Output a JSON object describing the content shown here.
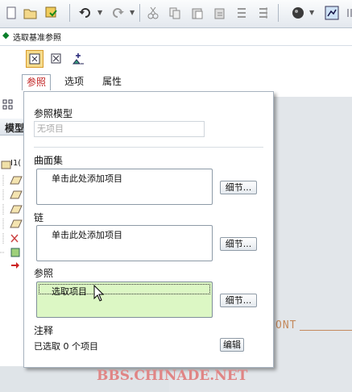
{
  "dashboard": {
    "title": "选取基准参照",
    "tabs": [
      {
        "label": "参照",
        "active": true
      },
      {
        "label": "选项",
        "active": false
      },
      {
        "label": "属性",
        "active": false
      }
    ]
  },
  "left_panel": {
    "header_label": "模型",
    "tree_first_item": "Ι1("
  },
  "panel": {
    "reference_model": {
      "label": "参照模型",
      "placeholder": "无项目"
    },
    "surface_set": {
      "label": "曲面集",
      "item": "单击此处添加项目",
      "details": "细节..."
    },
    "chain": {
      "label": "链",
      "item": "单击此处添加项目",
      "details": "细节..."
    },
    "references": {
      "label": "参照",
      "item": "选取项目",
      "details": "细节..."
    },
    "notes": {
      "label": "注释",
      "status": "已选取 0 个项目",
      "edit": "编辑"
    }
  },
  "canvas": {
    "text": "ONT"
  },
  "watermark": "BBS.CHINADE.NET",
  "colors": {
    "active_tab": "#c02020",
    "active_list": "#dcf7c4",
    "watermark": "#e08585"
  }
}
